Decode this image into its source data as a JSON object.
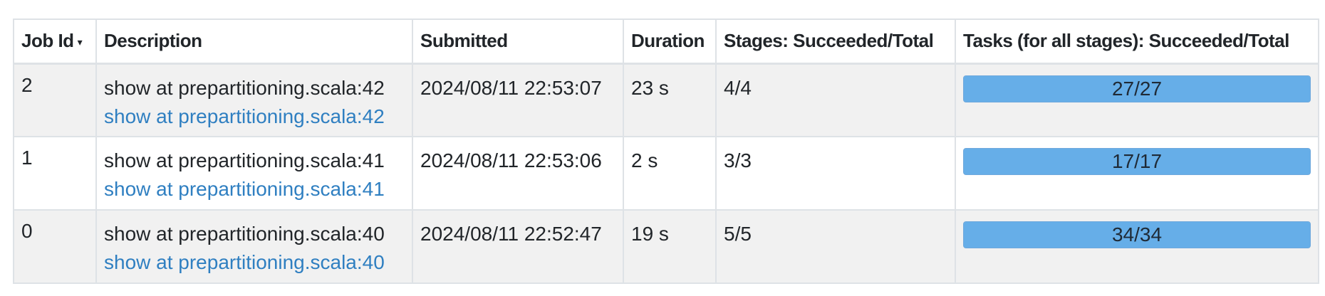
{
  "table": {
    "headers": {
      "job_id": "Job Id",
      "sort_indicator": "▾",
      "description": "Description",
      "submitted": "Submitted",
      "duration": "Duration",
      "stages": "Stages: Succeeded/Total",
      "tasks": "Tasks (for all stages): Succeeded/Total"
    },
    "rows": [
      {
        "job_id": "2",
        "description": "show at prepartitioning.scala:42",
        "link": "show at prepartitioning.scala:42",
        "submitted": "2024/08/11 22:53:07",
        "duration": "23 s",
        "stages": "4/4",
        "tasks": "27/27",
        "tasks_progress": 1.0
      },
      {
        "job_id": "1",
        "description": "show at prepartitioning.scala:41",
        "link": "show at prepartitioning.scala:41",
        "submitted": "2024/08/11 22:53:06",
        "duration": "2 s",
        "stages": "3/3",
        "tasks": "17/17",
        "tasks_progress": 1.0
      },
      {
        "job_id": "0",
        "description": "show at prepartitioning.scala:40",
        "link": "show at prepartitioning.scala:40",
        "submitted": "2024/08/11 22:52:47",
        "duration": "19 s",
        "stages": "5/5",
        "tasks": "34/34",
        "tasks_progress": 1.0
      }
    ]
  },
  "colors": {
    "link": "#2f7fc1",
    "progress_bar": "#66aee8",
    "row_stripe": "#f1f1f1",
    "border": "#dee2e6"
  }
}
